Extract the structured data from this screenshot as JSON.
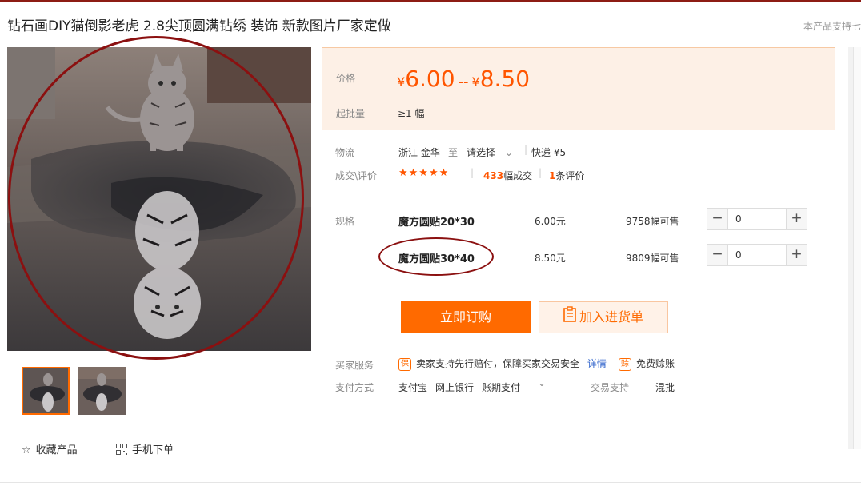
{
  "product": {
    "title": "钻石画DIY猫倒影老虎 2.8尖顶圆满钻绣 装饰 新款图片厂家定做",
    "support_note": "本产品支持七"
  },
  "gallery": {
    "thumbs": [
      "thumb-1",
      "thumb-2"
    ],
    "favorite_label": "收藏产品",
    "mobile_label": "手机下单"
  },
  "price": {
    "label": "价格",
    "currency": "¥",
    "low": "6.00",
    "high": "8.50",
    "range_sep": "--",
    "moq_label": "起批量",
    "moq_value": "≥1 幅"
  },
  "logistics": {
    "label": "物流",
    "origin": "浙江 金华",
    "to": "至",
    "dest": "请选择",
    "express": "快递 ¥5"
  },
  "reviews": {
    "label": "成交\\评价",
    "stars": "★★★★★",
    "sold_count": "433",
    "sold_suffix": "幅成交",
    "review_count": "1",
    "review_suffix": "条评价"
  },
  "sku": {
    "label": "规格",
    "items": [
      {
        "name": "魔方圆贴20*30",
        "price": "6.00元",
        "stock": "9758幅可售",
        "qty": "0"
      },
      {
        "name": "魔方圆贴30*40",
        "price": "8.50元",
        "stock": "9809幅可售",
        "qty": "0"
      }
    ]
  },
  "buttons": {
    "buy_now": "立即订购",
    "add_to_list": "加入进货单"
  },
  "services": {
    "label": "买家服务",
    "badge1": "保",
    "text1": "卖家支持先行赔付，保障买家交易安全",
    "detail_link": "详情",
    "badge2": "赊",
    "text2": "免费赊账"
  },
  "payment": {
    "label": "支付方式",
    "methods": [
      "支付宝",
      "网上银行",
      "账期支付"
    ],
    "trade_label": "交易支持",
    "trade_value": "混批"
  },
  "colors": {
    "accent": "#ff6a00",
    "price": "#ff5500",
    "annotation": "#8b1010"
  }
}
